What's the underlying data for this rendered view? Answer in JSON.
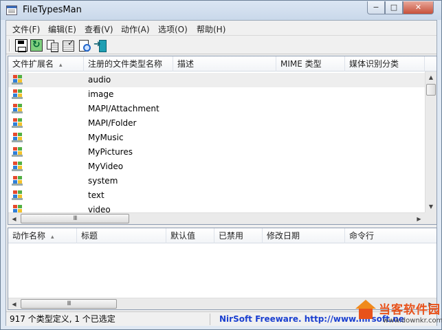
{
  "window": {
    "title": "FileTypesMan",
    "min_glyph": "−",
    "max_glyph": "□",
    "close_glyph": "✕"
  },
  "menu": [
    "文件(F)",
    "编辑(E)",
    "查看(V)",
    "动作(A)",
    "选项(O)",
    "帮助(H)"
  ],
  "toolbar": {
    "icons": [
      "save-icon",
      "refresh-icon",
      "copy-icon",
      "properties-icon",
      "find-icon",
      "exit-icon"
    ]
  },
  "top_table": {
    "columns": [
      "文件扩展名",
      "注册的文件类型名称",
      "描述",
      "MIME 类型",
      "媒体识别分类"
    ],
    "sort_glyph": "▴",
    "rows": [
      {
        "type_name": "audio",
        "selected": true
      },
      {
        "type_name": "image"
      },
      {
        "type_name": "MAPI/Attachment"
      },
      {
        "type_name": "MAPI/Folder"
      },
      {
        "type_name": "MyMusic"
      },
      {
        "type_name": "MyPictures"
      },
      {
        "type_name": "MyVideo"
      },
      {
        "type_name": "system"
      },
      {
        "type_name": "text"
      },
      {
        "type_name": "video"
      }
    ]
  },
  "bottom_table": {
    "columns": [
      "动作名称",
      "标题",
      "默认值",
      "已禁用",
      "修改日期",
      "命令行"
    ],
    "sort_glyph": "▴"
  },
  "scroll": {
    "thumb_grip": "III",
    "up": "▲",
    "down": "▼",
    "left": "◀",
    "right": "▶"
  },
  "status": {
    "left": "917 个类型定义, 1 个已选定",
    "right": "NirSoft Freeware.  http://www.nirsoft.ne"
  },
  "watermark": {
    "name": "当客软件园",
    "url": "www.downkr.com"
  },
  "colors": {
    "status_link": "#1a3fd0",
    "watermark": "#e8521b"
  }
}
